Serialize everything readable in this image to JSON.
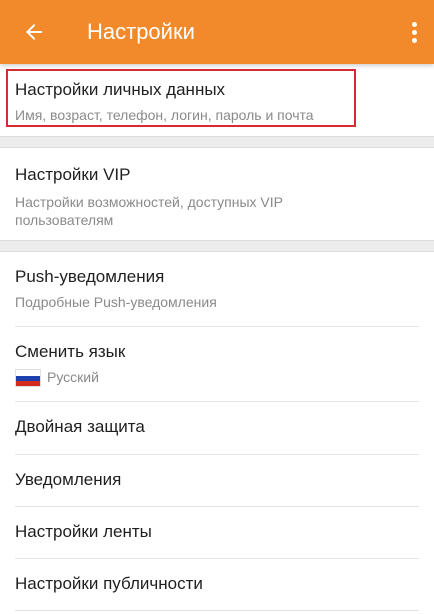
{
  "header": {
    "title": "Настройки",
    "back_icon": "arrow-left-icon",
    "more_icon": "more-vert-icon",
    "color": "#f2892a"
  },
  "sections": [
    {
      "items": [
        {
          "label": "Настройки личных данных",
          "sub": "Имя, возраст, телефон, логин, пароль и почта",
          "highlighted": true
        }
      ]
    },
    {
      "items": [
        {
          "label": "Настройки VIP",
          "sub": "Настройки возможностей, доступных VIP пользователям"
        }
      ]
    },
    {
      "items": [
        {
          "label": "Push-уведомления",
          "sub": "Подробные Push-уведомления"
        },
        {
          "label": "Сменить язык",
          "sub": "Русский",
          "sub_icon": "russian-flag-icon"
        },
        {
          "label": "Двойная защита"
        },
        {
          "label": "Уведомления"
        },
        {
          "label": "Настройки ленты"
        },
        {
          "label": "Настройки публичности"
        }
      ]
    }
  ],
  "highlight_color": "#d62a37"
}
